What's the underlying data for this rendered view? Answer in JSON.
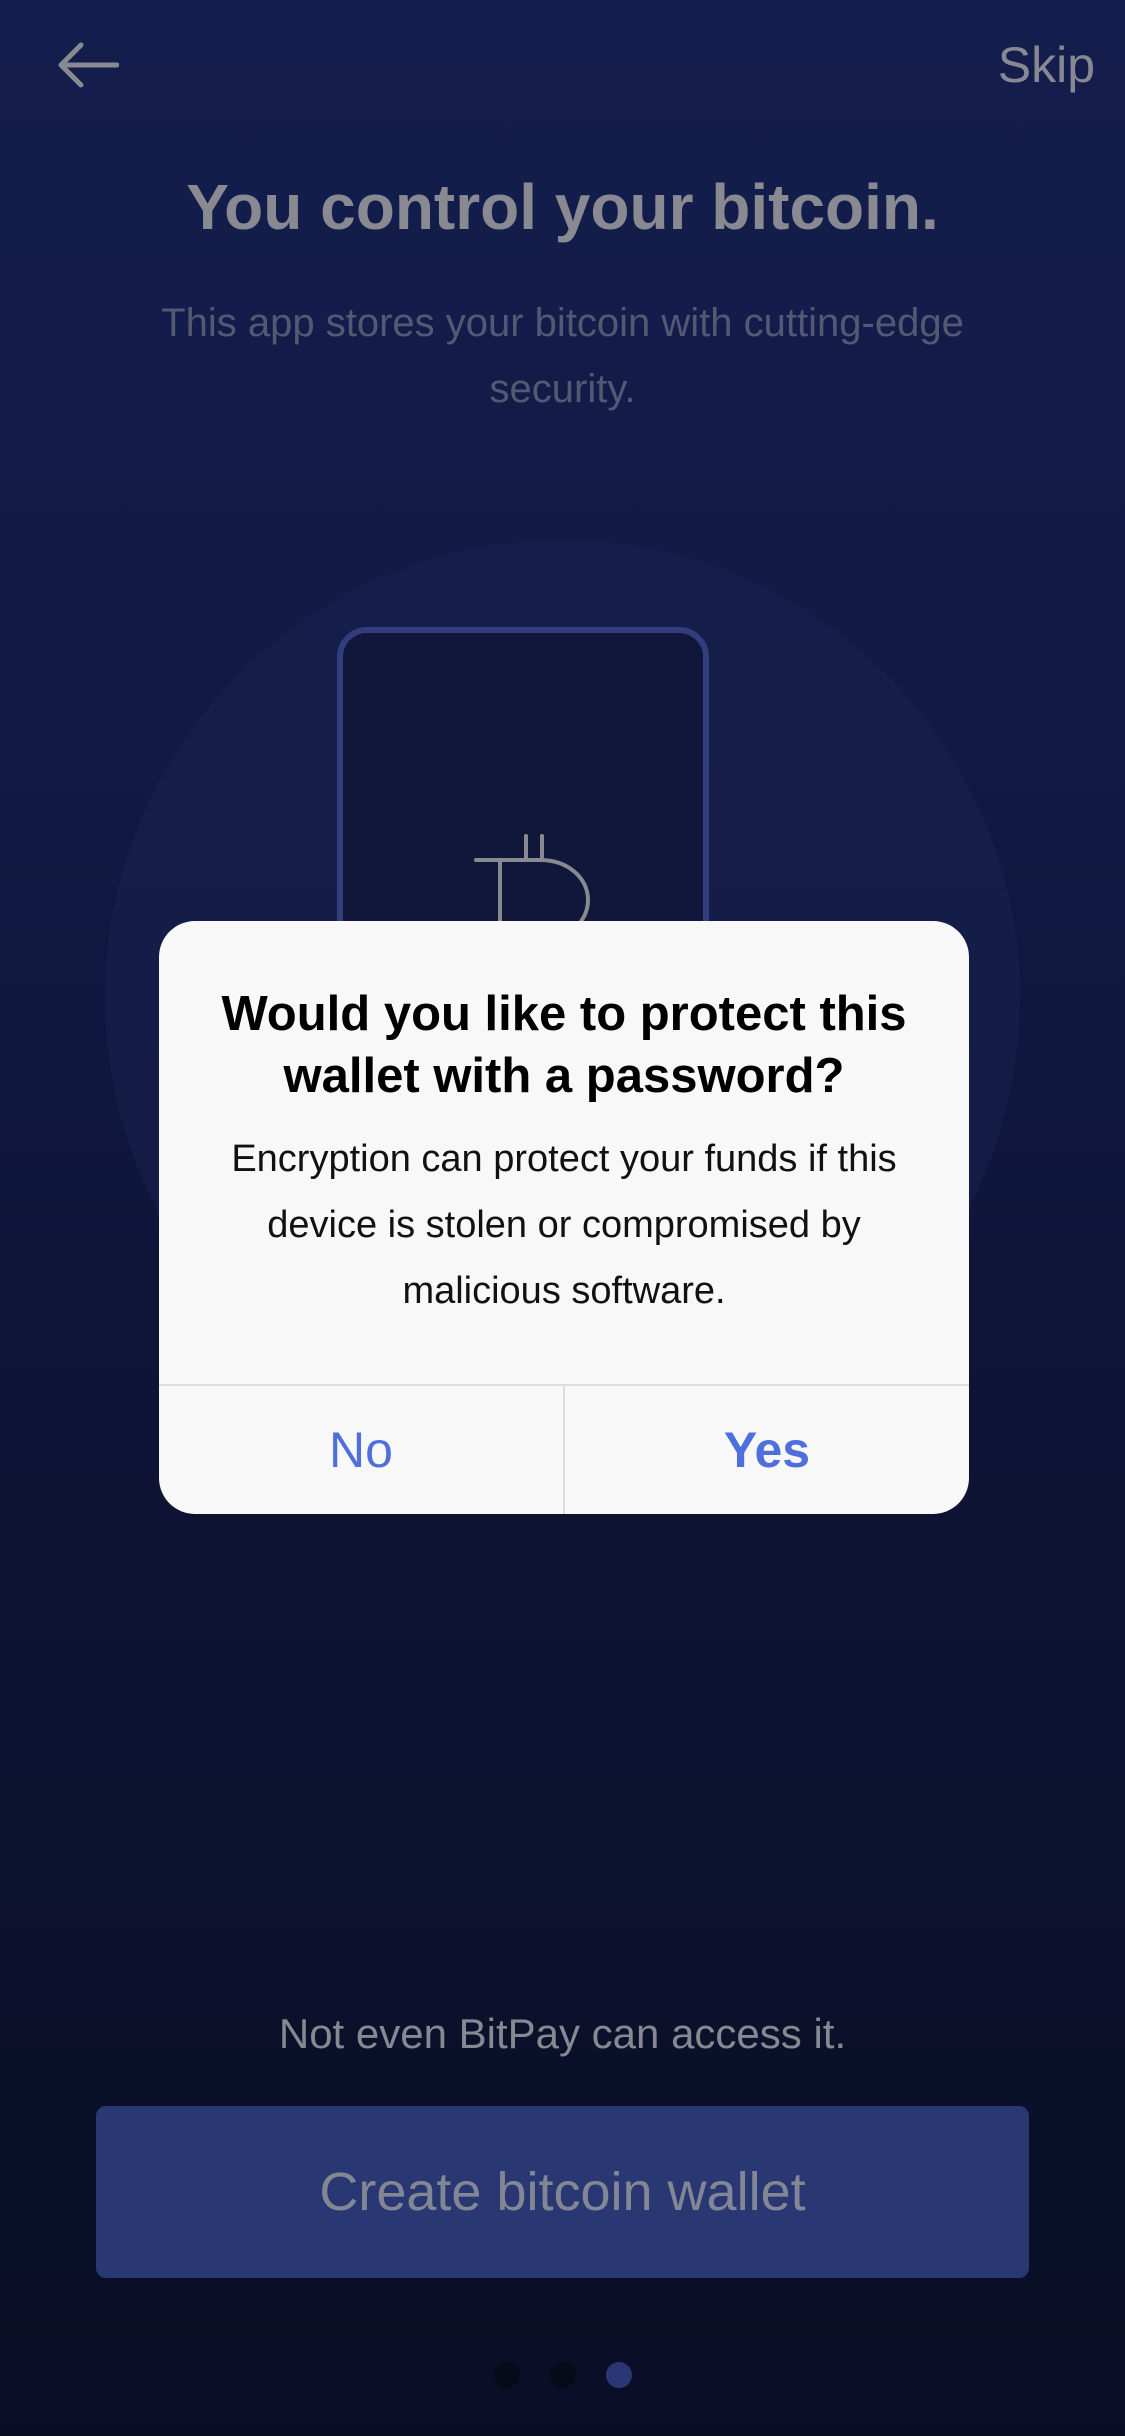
{
  "header": {
    "back_icon": "arrow-left-icon",
    "skip_label": "Skip"
  },
  "onboarding": {
    "title": "You control your bitcoin.",
    "subtitle": "This app stores your bitcoin with cutting-edge security.",
    "illustration_icon": "bitcoin-icon",
    "tagline": "Not even BitPay can access it.",
    "create_button_label": "Create bitcoin wallet",
    "pager": {
      "total": 3,
      "active_index": 2
    }
  },
  "dialog": {
    "title": "Would you like to protect this wallet with a password?",
    "message": "Encryption can protect your funds if this device is stolen or compromised by malicious software.",
    "no_label": "No",
    "yes_label": "Yes"
  },
  "colors": {
    "accent": "#4f70dc",
    "primary_button": "#3d52a8",
    "background_top": "#1e2d73",
    "background_bottom": "#0f1637"
  }
}
